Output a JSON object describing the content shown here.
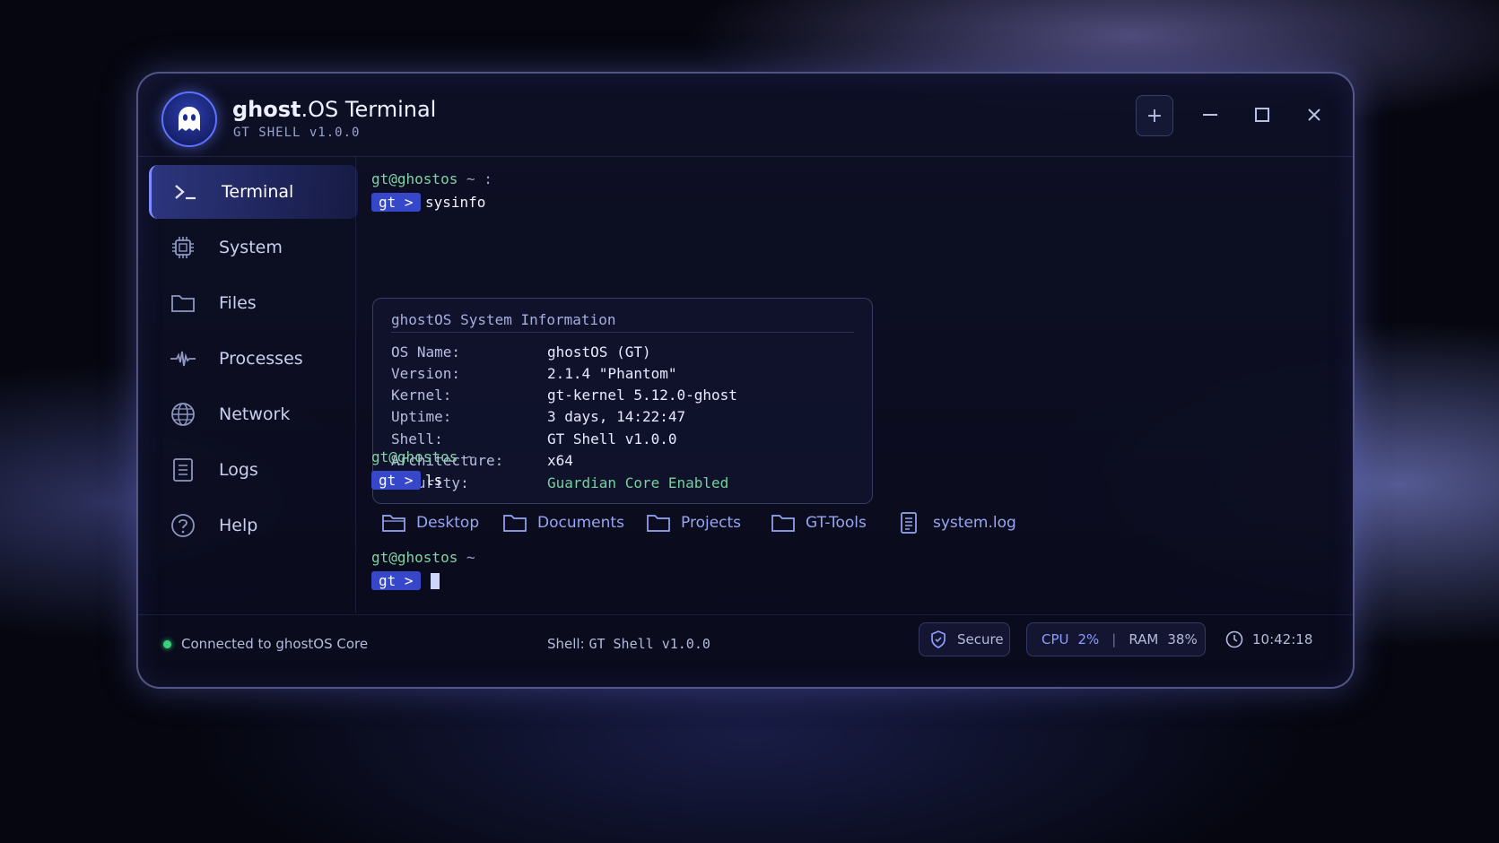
{
  "app": {
    "title_bold": "ghost",
    "title_rest": ".OS Terminal",
    "subtitle": "GT SHELL v1.0.0"
  },
  "window_controls": {
    "new_tab": "+",
    "minimize": "–",
    "maximize": "□",
    "close": "✕"
  },
  "sidebar": {
    "items": [
      {
        "label": "Terminal",
        "icon": "terminal-icon",
        "active": true
      },
      {
        "label": "System",
        "icon": "chip-icon"
      },
      {
        "label": "Files",
        "icon": "folder-icon"
      },
      {
        "label": "Processes",
        "icon": "pulse-icon"
      },
      {
        "label": "Network",
        "icon": "globe-icon"
      },
      {
        "label": "Logs",
        "icon": "document-icon"
      },
      {
        "label": "Help",
        "icon": "help-icon"
      }
    ]
  },
  "terminal": {
    "host": "gt@ghostos",
    "host_suffix_1": "~ :",
    "host_suffix": "~",
    "badge": "gt >",
    "cmd1": "sysinfo",
    "cmd2": "ls",
    "info": {
      "title": "ghostOS System Information",
      "rows": [
        {
          "key": "OS Name:",
          "value": "ghostOS (GT)"
        },
        {
          "key": "Version:",
          "value": "2.1.4 \"Phantom\""
        },
        {
          "key": "Kernel:",
          "value": "gt-kernel 5.12.0-ghost"
        },
        {
          "key": "Uptime:",
          "value": "3 days, 14:22:47"
        },
        {
          "key": "Shell:",
          "value": "GT Shell v1.0.0"
        },
        {
          "key": "Architecture:",
          "value": "x64"
        },
        {
          "key": "Security:",
          "value": "Guardian Core Enabled",
          "color": "#74d29a"
        }
      ]
    },
    "ls": [
      {
        "name": "Desktop",
        "type": "folder"
      },
      {
        "name": "Documents",
        "type": "folder"
      },
      {
        "name": "Projects",
        "type": "folder"
      },
      {
        "name": "GT-Tools",
        "type": "folder"
      },
      {
        "name": "system.log",
        "type": "file"
      }
    ]
  },
  "status": {
    "connection": "Connected to ghostOS Core",
    "shell_label": "Shell:",
    "shell_value": "GT Shell v1.0.0",
    "secure": "Secure",
    "cpu_label": "CPU",
    "cpu_value": "2%",
    "ram_label": "RAM",
    "ram_value": "38%",
    "time": "10:42:18"
  },
  "colors": {
    "accent": "#3648c9",
    "prompt_green": "#7fd3a4",
    "status_green": "#3bd07a",
    "link_blue": "#97a6f2"
  }
}
